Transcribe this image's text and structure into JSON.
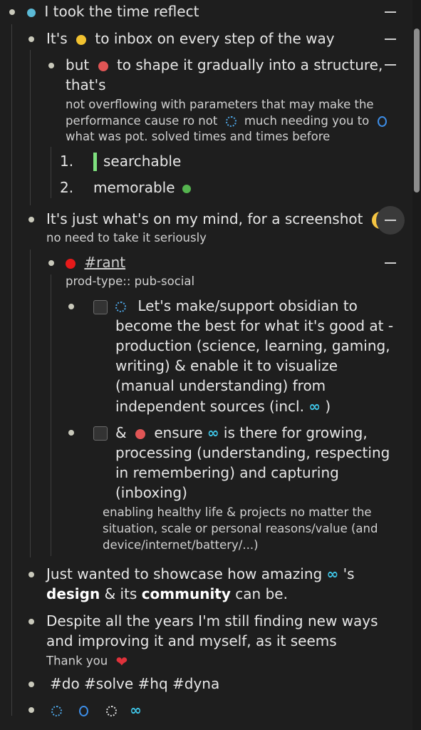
{
  "colors": {
    "bg": "#1e1e1e",
    "teal_dot": "#5bbad6",
    "yellow_dot": "#f2c230",
    "red_dot": "#e05555",
    "green_dot": "#55b44f",
    "bright_red": "#e61a1a",
    "infinity": "#3fc6e8"
  },
  "items": {
    "l1": "I took the time reflect",
    "l2_a": "It's",
    "l2_b": "to inbox on every step of the way",
    "l3_a": "but",
    "l3_b": "to shape it gradually into a structure,",
    "l3_c": "that's",
    "l3_sub1": "not overflowing with parameters that may make the",
    "l3_sub2a": "performance cause ro not",
    "l3_sub2b": "much needing you to",
    "l3_sub3": "what was pot. solved times and times before",
    "list1_num": "1.",
    "list1_text": "searchable",
    "list2_num": "2.",
    "list2_text": "memorable",
    "l4": "It's just what's on my mind, for a screenshot",
    "l4_sub": "no need to take it seriously",
    "rant_tag": "#rant",
    "rant_prop": "prod-type:: pub-social",
    "task1_line1": "Let's make/support obsidian to",
    "task1_line2": "become the best for what it's good at -",
    "task1_line3": "production (science, learning, gaming,",
    "task1_line4": "writing) & enable it to visualize",
    "task1_line5": "(manual understanding) from",
    "task1_line6a": "independent sources (incl.",
    "task1_line6b": ")",
    "task2_a": "&",
    "task2_b": "ensure",
    "task2_c": "is there for growing,",
    "task2_line2": "processing (understanding, respecting",
    "task2_line3": "in remembering) and capturing",
    "task2_line4": "(inboxing)",
    "task2_sub1": "enabling healthy life & projects no matter the",
    "task2_sub2": "situation, scale or personal reasons/value (and",
    "task2_sub3": "device/internet/battery/...)",
    "l5_a": "Just wanted to showcase how amazing",
    "l5_b": "'s",
    "l5_c": "design",
    "l5_d": "& its",
    "l5_e": "community",
    "l5_f": "can be.",
    "l6_line1": "Despite all the years I'm still finding new ways",
    "l6_line2": "and improving it and myself, as it seems",
    "l6_sub": "Thank you",
    "l7": "#do #solve #hq #dyna",
    "infinity": "∞"
  },
  "icons": [
    "collapse-icon",
    "circle-dot-icon",
    "dashed-circle-icon",
    "ring-icon",
    "grinning-face-emoji",
    "heart-emoji",
    "checkbox-icon",
    "infinity-symbol"
  ]
}
